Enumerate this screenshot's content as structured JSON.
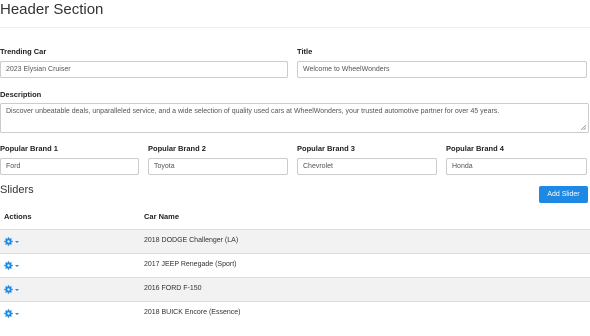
{
  "header": {
    "title": "Header Section",
    "trending_label": "Trending Car",
    "trending_value": "2023 Elysian Cruiser",
    "title_label": "Title",
    "title_value": "Welcome to WheelWonders",
    "description_label": "Description",
    "description_value": "Discover unbeatable deals, unparalleled service, and a wide selection of quality used cars at WheelWonders, your trusted automotive partner for over 45 years.",
    "brands": [
      {
        "label": "Popular Brand 1",
        "value": "Ford"
      },
      {
        "label": "Popular Brand 2",
        "value": "Toyota"
      },
      {
        "label": "Popular Brand 3",
        "value": "Chevrolet"
      },
      {
        "label": "Popular Brand 4",
        "value": "Honda"
      }
    ]
  },
  "sliders": {
    "title": "Sliders",
    "add_label": "Add Slider",
    "col_actions": "Actions",
    "col_car": "Car Name",
    "rows": [
      "2018 DODGE Challenger (LA)",
      "2017 JEEP Renegade (Sport)",
      "2016 FORD F-150",
      "2018 BUICK Encore (Essence)"
    ]
  },
  "colors": {
    "accent": "#1e88e5",
    "row_alt": "#f2f2f2"
  },
  "icons": {
    "action": "gear-icon",
    "dropdown": "caret-down-icon"
  }
}
